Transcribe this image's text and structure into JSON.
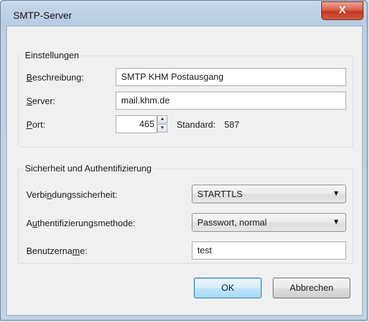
{
  "window": {
    "title": "SMTP-Server",
    "close_label": "X"
  },
  "settings": {
    "legend": "Einstellungen",
    "description_label_u": "B",
    "description_label_rest": "eschreibung:",
    "description_value": "SMTP KHM Postausgang",
    "server_label_u": "S",
    "server_label_rest": "erver:",
    "server_value": "mail.khm.de",
    "port_label_u": "P",
    "port_label_rest": "ort:",
    "port_value": "465",
    "standard_label": "Standard:",
    "standard_value": "587"
  },
  "security": {
    "legend": "Sicherheit und Authentifizierung",
    "connection_label_pre": "Verbi",
    "connection_label_u": "n",
    "connection_label_post": "dungssicherheit:",
    "connection_value": "STARTTLS",
    "auth_label_pre": "A",
    "auth_label_u": "u",
    "auth_label_post": "thentifizierungsmethode:",
    "auth_value": "Passwort, normal",
    "user_label_pre": "Benutzerna",
    "user_label_u": "m",
    "user_label_post": "e:",
    "user_value": "test"
  },
  "buttons": {
    "ok": "OK",
    "cancel": "Abbrechen"
  }
}
